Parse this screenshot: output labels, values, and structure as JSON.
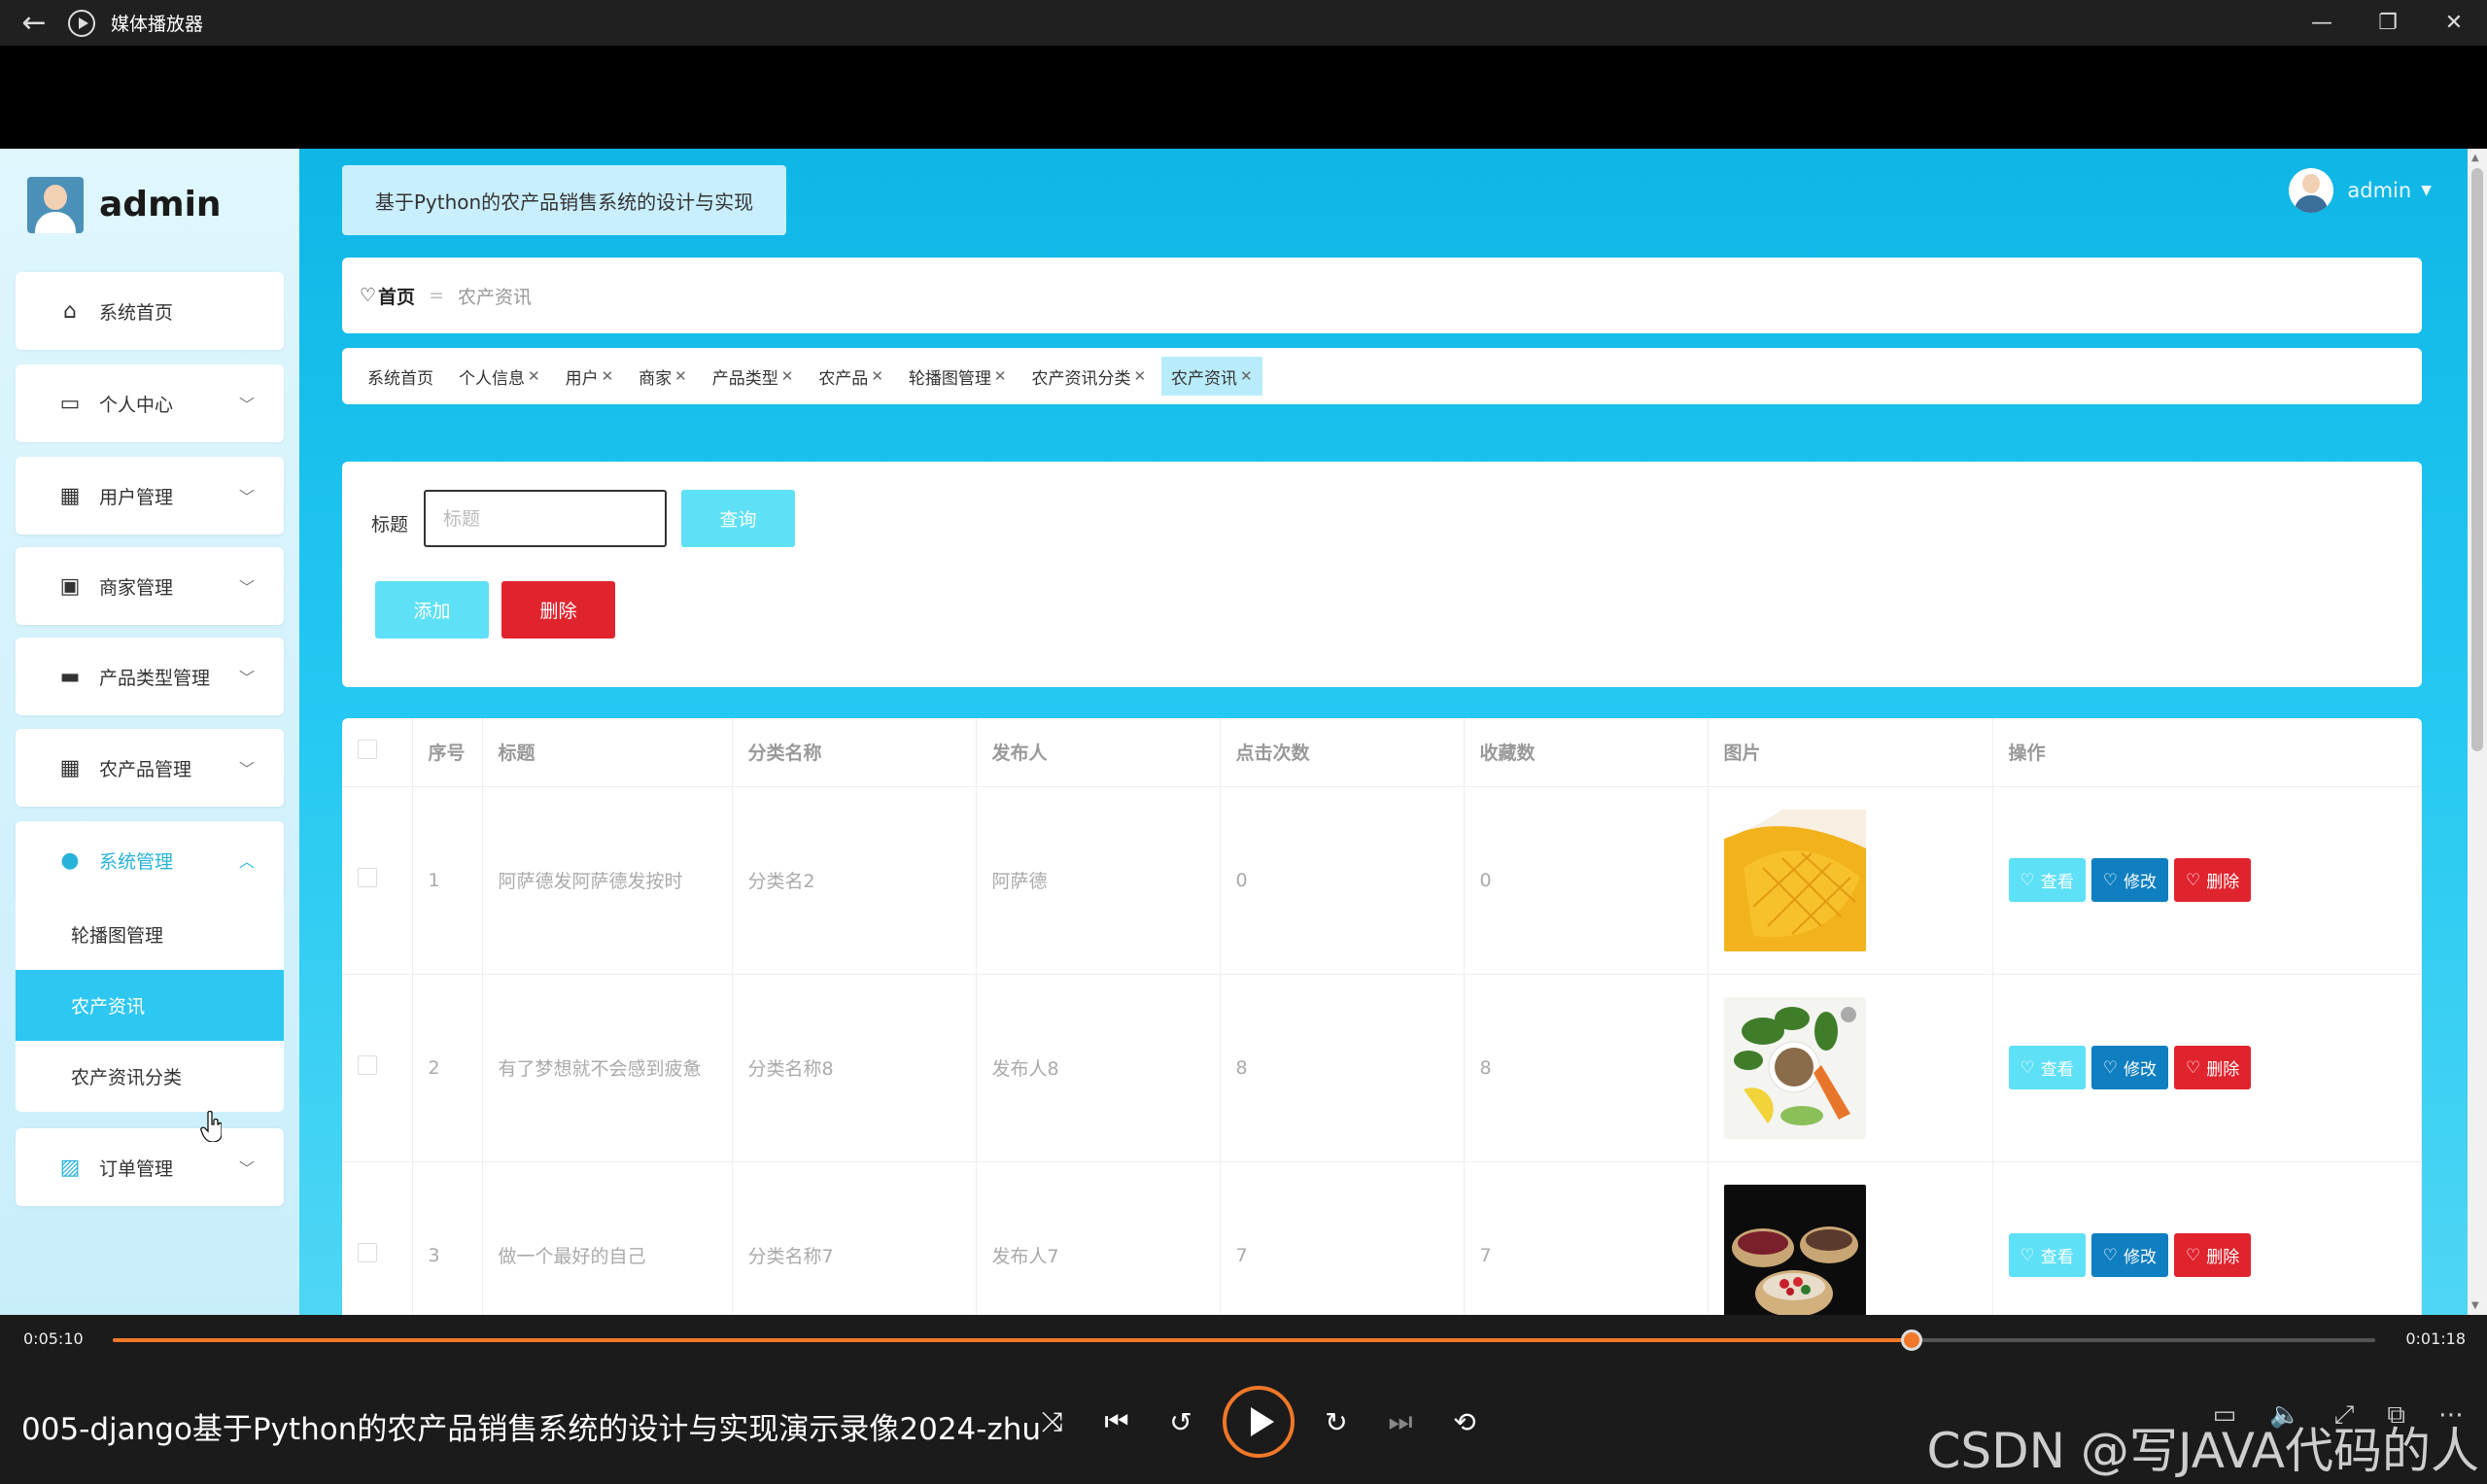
{
  "window": {
    "title": "媒体播放器",
    "controls": {
      "minimize": "—",
      "restore": "❐",
      "close": "✕"
    }
  },
  "sidebar": {
    "user": "admin",
    "items": [
      {
        "label": "系统首页",
        "icon": "home-icon",
        "glyph": "⌂"
      },
      {
        "label": "个人中心",
        "icon": "card-icon",
        "glyph": "▭"
      },
      {
        "label": "用户管理",
        "icon": "grid-icon",
        "glyph": "▦"
      },
      {
        "label": "商家管理",
        "icon": "clipboard-icon",
        "glyph": "▣"
      },
      {
        "label": "产品类型管理",
        "icon": "briefcase-icon",
        "glyph": "▬"
      },
      {
        "label": "农产品管理",
        "icon": "grid-icon",
        "glyph": "▦"
      },
      {
        "label": "系统管理",
        "icon": "person-icon",
        "glyph": "●"
      },
      {
        "label": "订单管理",
        "icon": "chart-icon",
        "glyph": "▨"
      }
    ],
    "submenu": [
      "轮播图管理",
      "农产资讯",
      "农产资讯分类"
    ]
  },
  "header": {
    "site_title": "基于Python的农产品销售系统的设计与实现",
    "user": "admin"
  },
  "breadcrumb": {
    "home": "首页",
    "separator": "=",
    "current": "农产资讯"
  },
  "tags": [
    {
      "label": "系统首页",
      "closable": false
    },
    {
      "label": "个人信息",
      "closable": true
    },
    {
      "label": "用户",
      "closable": true
    },
    {
      "label": "商家",
      "closable": true
    },
    {
      "label": "产品类型",
      "closable": true
    },
    {
      "label": "农产品",
      "closable": true
    },
    {
      "label": "轮播图管理",
      "closable": true
    },
    {
      "label": "农产资讯分类",
      "closable": true
    },
    {
      "label": "农产资讯",
      "closable": true
    }
  ],
  "search": {
    "label": "标题",
    "placeholder": "标题",
    "query_button": "查询",
    "add_button": "添加",
    "delete_button": "删除"
  },
  "table": {
    "headers": [
      "序号",
      "标题",
      "分类名称",
      "发布人",
      "点击次数",
      "收藏数",
      "图片",
      "操作"
    ],
    "rows": [
      {
        "index": "1",
        "title": "阿萨德发阿萨德发按时",
        "category": "分类名2",
        "publisher": "阿萨德",
        "clicks": "0",
        "favorites": "0",
        "image": "mango"
      },
      {
        "index": "2",
        "title": "有了梦想就不会感到疲惫",
        "category": "分类名称8",
        "publisher": "发布人8",
        "clicks": "8",
        "favorites": "8",
        "image": "spices"
      },
      {
        "index": "3",
        "title": "做一个最好的自己",
        "category": "分类名称7",
        "publisher": "发布人7",
        "clicks": "7",
        "favorites": "7",
        "image": "baskets"
      }
    ],
    "actions": {
      "view": "查看",
      "edit": "修改",
      "delete": "删除"
    }
  },
  "player": {
    "elapsed": "0:05:10",
    "remaining": "0:01:18",
    "progress": 0.795,
    "video_title": "005-django基于Python的农产品销售系统的设计与实现演示录像2024-zhu",
    "watermark": "CSDN @写JAVA代码的人",
    "accent": "#f07828"
  }
}
